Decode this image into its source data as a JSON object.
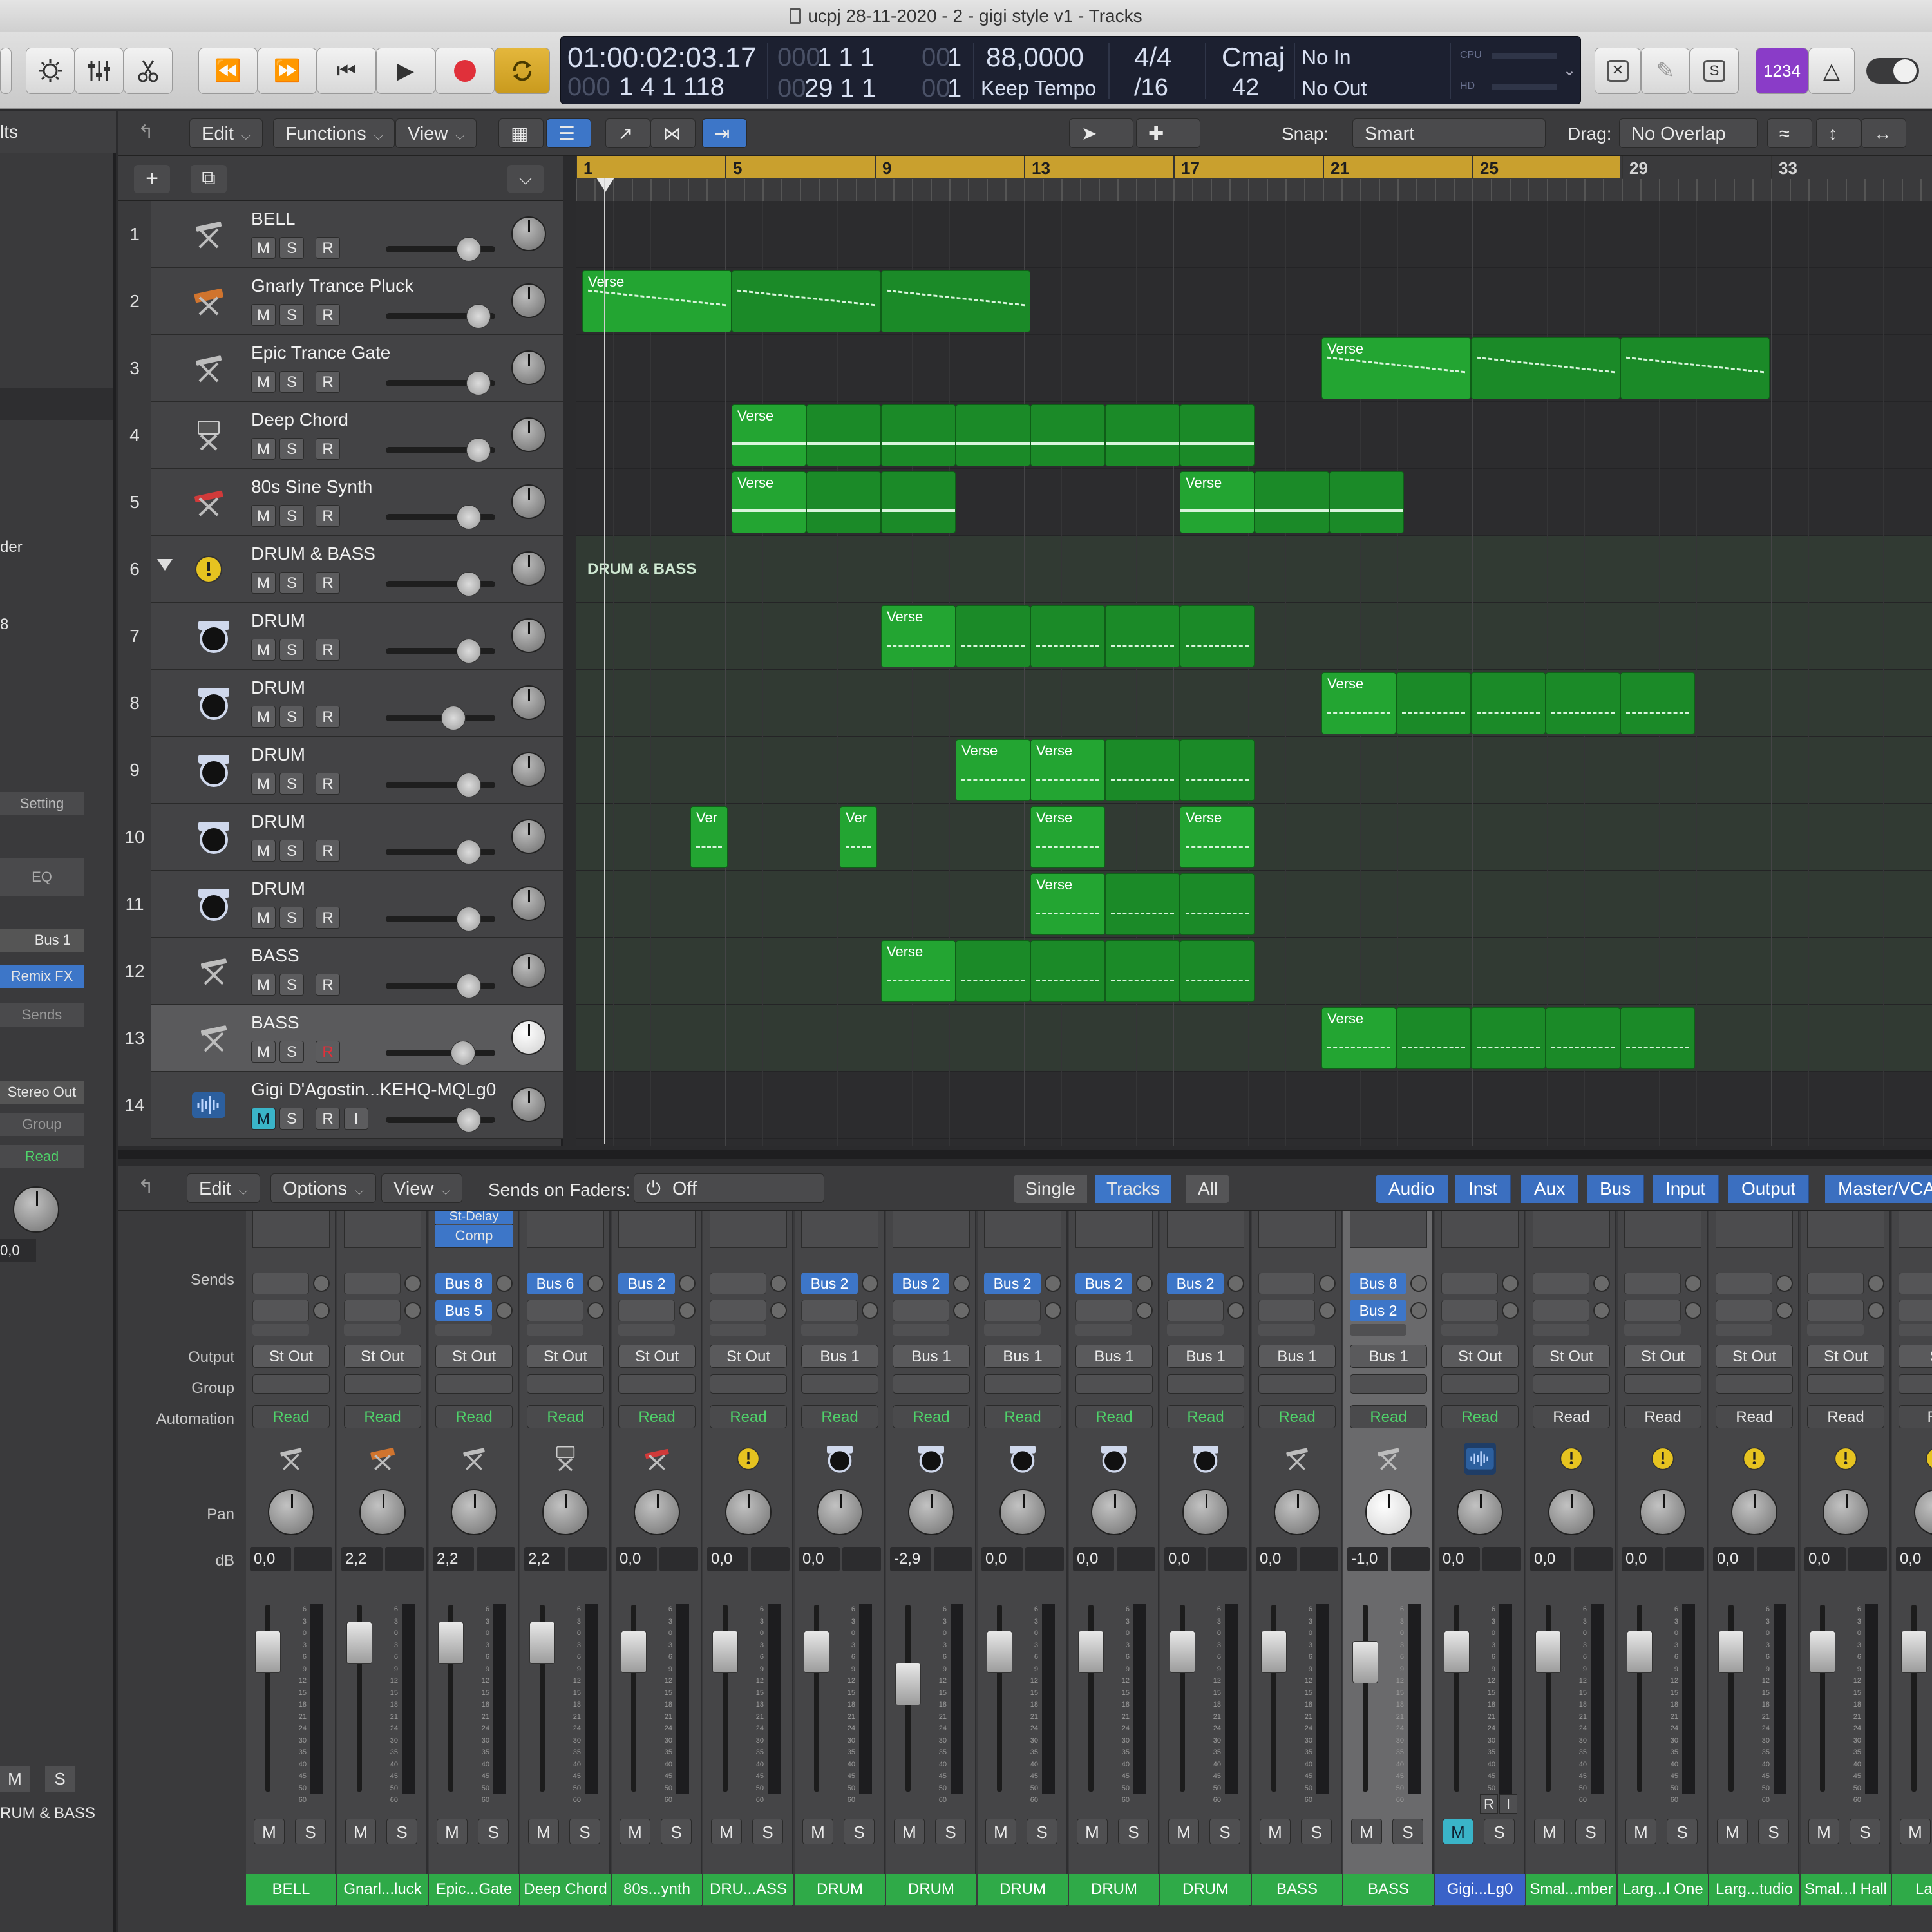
{
  "window": {
    "title": "ucpj 28-11-2020 - 2 - gigi style v1 - Tracks"
  },
  "lcd": {
    "time": "01:00:02:03.17",
    "time_dim": "000",
    "time_bars_1": "1  1  1",
    "time_dim2": "00",
    "time_ticks_1": "1",
    "pos_dim": "000",
    "position": "1  4  1  118",
    "pos2_dim": "00",
    "pos2": "29  1  1",
    "pos2_dim2": "00",
    "pos2_ticks": "1",
    "tempo": "88,0000",
    "tempo_mode": "Keep Tempo",
    "sig_top": "4/4",
    "sig_bottom": "/16",
    "key": "Cmaj",
    "key_num": "42",
    "midi_in": "No In",
    "midi_out": "No Out",
    "cpu_label": "CPU",
    "hd_label": "HD"
  },
  "controlbar": {
    "counter_badge": "1234"
  },
  "tracks_menu": {
    "edit": "Edit",
    "functions": "Functions",
    "view": "View",
    "snap_label": "Snap:",
    "snap_value": "Smart",
    "drag_label": "Drag:",
    "drag_value": "No Overlap"
  },
  "ruler": {
    "bars": [
      "1",
      "5",
      "9",
      "13",
      "17",
      "21",
      "25",
      "29",
      "33"
    ]
  },
  "tracks": [
    {
      "num": "1",
      "name": "BELL"
    },
    {
      "num": "2",
      "name": "Gnarly Trance Pluck"
    },
    {
      "num": "3",
      "name": "Epic Trance Gate"
    },
    {
      "num": "4",
      "name": "Deep Chord"
    },
    {
      "num": "5",
      "name": "80s Sine Synth"
    },
    {
      "num": "6",
      "name": "DRUM & BASS"
    },
    {
      "num": "7",
      "name": "DRUM"
    },
    {
      "num": "8",
      "name": "DRUM"
    },
    {
      "num": "9",
      "name": "DRUM"
    },
    {
      "num": "10",
      "name": "DRUM"
    },
    {
      "num": "11",
      "name": "DRUM"
    },
    {
      "num": "12",
      "name": "BASS"
    },
    {
      "num": "13",
      "name": "BASS"
    },
    {
      "num": "14",
      "name": "Gigi D'Agostin...KEHQ-MQLg0"
    }
  ],
  "track_buttons": {
    "m": "M",
    "s": "S",
    "r": "R",
    "i": "I"
  },
  "regions": {
    "verse": "Verse",
    "ver": "Ver",
    "folder": "DRUM & BASS"
  },
  "inspector": {
    "top_label": "lts",
    "der_label": "der",
    "eight": "8",
    "setting": "Setting",
    "eq": "EQ",
    "bus1": "Bus 1",
    "remix_fx": "Remix FX",
    "sends": "Sends",
    "stereo_out": "Stereo Out",
    "group": "Group",
    "read": "Read",
    "db": "0,0",
    "m": "M",
    "s": "S",
    "name": "RUM & BASS"
  },
  "mixer_menu": {
    "edit": "Edit",
    "options": "Options",
    "view": "View",
    "sends_on_faders": "Sends on Faders:",
    "off": "Off",
    "single": "Single",
    "tracks": "Tracks",
    "all": "All",
    "filters": [
      "Audio",
      "Inst",
      "Aux",
      "Bus",
      "Input",
      "Output",
      "Master/VCA"
    ]
  },
  "mixer_labels": {
    "sends": "Sends",
    "output": "Output",
    "group": "Group",
    "automation": "Automation",
    "pan": "Pan",
    "db": "dB"
  },
  "plugins": {
    "st_delay": "St-Delay",
    "comp": "Comp"
  },
  "strips": [
    {
      "name": "BELL",
      "output": "St Out",
      "auto": "Read",
      "db": "0,0",
      "sends": []
    },
    {
      "name": "Gnarl...luck",
      "output": "St Out",
      "auto": "Read",
      "db": "2,2",
      "sends": []
    },
    {
      "name": "Epic...Gate",
      "output": "St Out",
      "auto": "Read",
      "db": "2,2",
      "sends": [
        "Bus 8",
        "Bus 5"
      ]
    },
    {
      "name": "Deep Chord",
      "output": "St Out",
      "auto": "Read",
      "db": "2,2",
      "sends": [
        "Bus 6"
      ]
    },
    {
      "name": "80s...ynth",
      "output": "St Out",
      "auto": "Read",
      "db": "0,0",
      "sends": [
        "Bus 2"
      ]
    },
    {
      "name": "DRU...ASS",
      "output": "St Out",
      "auto": "Read",
      "db": "0,0",
      "sends": []
    },
    {
      "name": "DRUM",
      "output": "Bus 1",
      "auto": "Read",
      "db": "0,0",
      "sends": [
        "Bus 2"
      ]
    },
    {
      "name": "DRUM",
      "output": "Bus 1",
      "auto": "Read",
      "db": "-2,9",
      "sends": [
        "Bus 2"
      ]
    },
    {
      "name": "DRUM",
      "output": "Bus 1",
      "auto": "Read",
      "db": "0,0",
      "sends": [
        "Bus 2"
      ]
    },
    {
      "name": "DRUM",
      "output": "Bus 1",
      "auto": "Read",
      "db": "0,0",
      "sends": [
        "Bus 2"
      ]
    },
    {
      "name": "DRUM",
      "output": "Bus 1",
      "auto": "Read",
      "db": "0,0",
      "sends": [
        "Bus 2"
      ]
    },
    {
      "name": "BASS",
      "output": "Bus 1",
      "auto": "Read",
      "db": "0,0",
      "sends": []
    },
    {
      "name": "BASS",
      "output": "Bus 1",
      "auto": "Read",
      "db": "-1,0",
      "sends": [
        "Bus 8",
        "Bus 2"
      ]
    },
    {
      "name": "Gigi...Lg0",
      "output": "St Out",
      "auto": "Read",
      "db": "0,0",
      "sends": []
    },
    {
      "name": "Smal...mber",
      "output": "St Out",
      "auto": "Read",
      "db": "0,0",
      "sends": []
    },
    {
      "name": "Larg...l One",
      "output": "St Out",
      "auto": "Read",
      "db": "0,0",
      "sends": []
    },
    {
      "name": "Larg...tudio",
      "output": "St Out",
      "auto": "Read",
      "db": "0,0",
      "sends": []
    },
    {
      "name": "Smal...l Hall",
      "output": "St Out",
      "auto": "Read",
      "db": "0,0",
      "sends": []
    },
    {
      "name": "Larg...",
      "output": "St",
      "auto": "Re",
      "db": "0,0",
      "sends": []
    }
  ],
  "strip_buttons": {
    "m": "M",
    "s": "S",
    "r": "R",
    "i": "I"
  },
  "meter_scale": [
    "6",
    "3",
    "0",
    "3",
    "6",
    "9",
    "12",
    "15",
    "18",
    "21",
    "24",
    "30",
    "35",
    "40",
    "45",
    "50",
    "60"
  ],
  "colors": {
    "region_green": "#23a532",
    "accent_blue": "#3d76c8",
    "read_green": "#4fd26a",
    "cycle_gold": "#c9a02e",
    "record_red": "#e0303a"
  }
}
